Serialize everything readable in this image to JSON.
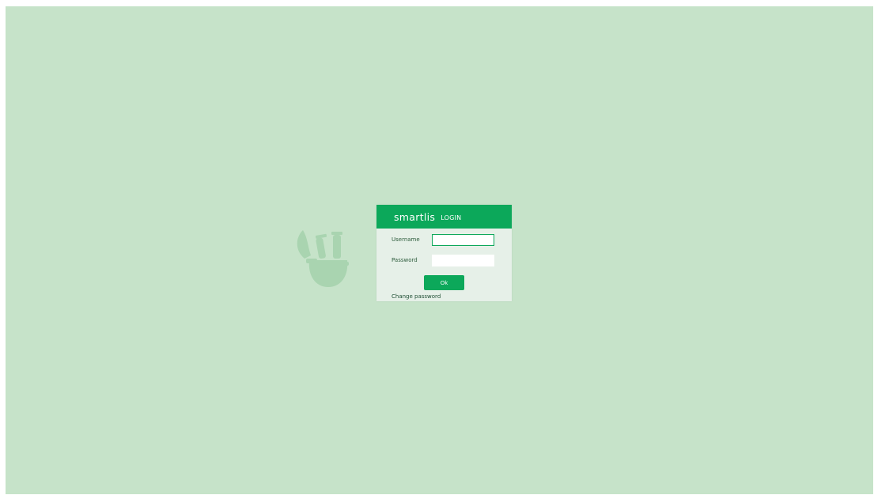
{
  "login_dialog": {
    "brand": "smartlis",
    "title": "LOGIN",
    "username_label": "Username",
    "username_value": "",
    "password_label": "Password",
    "password_value": "",
    "ok_label": "Ok",
    "change_password_label": "Change password"
  },
  "colors": {
    "background": "#c6e3c9",
    "accent": "#0ca85a",
    "dialog_body": "#e6f0e8"
  },
  "icons": {
    "background_logo": "lab-flask-logo-icon"
  }
}
